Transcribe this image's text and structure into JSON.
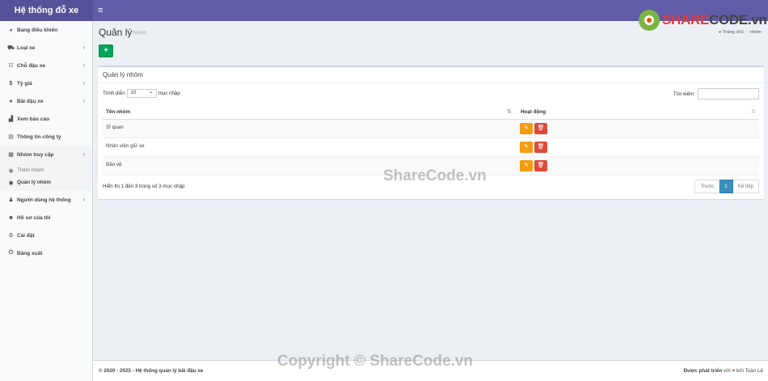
{
  "app": {
    "brand": "Hệ thống đỗ xe",
    "menu_icon": "bars-icon"
  },
  "logo": {
    "part1": "SHARE",
    "part2": "CODE",
    "suffix": ".vn"
  },
  "sidebar": {
    "items": [
      {
        "label": "Bảng điều khiển",
        "icon": "dashboard-icon",
        "has_children": false
      },
      {
        "label": "Loại xe",
        "icon": "car-icon",
        "has_children": true
      },
      {
        "label": "Chỗ đậu xe",
        "icon": "list-icon",
        "has_children": true
      },
      {
        "label": "Tỷ giá",
        "icon": "dollar-icon",
        "has_children": true
      },
      {
        "label": "Bãi đậu xe",
        "icon": "parking-icon",
        "has_children": true
      },
      {
        "label": "Xem báo cáo",
        "icon": "chart-icon",
        "has_children": false
      },
      {
        "label": "Thông tin công ty",
        "icon": "building-icon",
        "has_children": false
      },
      {
        "label": "Nhóm truy cập",
        "icon": "grid-icon",
        "has_children": true
      },
      {
        "label": "Người dùng hệ thống",
        "icon": "user-icon",
        "has_children": true
      },
      {
        "label": "Hồ sơ của tôi",
        "icon": "user-circle-icon",
        "has_children": false
      },
      {
        "label": "Cài đặt",
        "icon": "gears-icon",
        "has_children": false
      },
      {
        "label": "Đăng xuất",
        "icon": "power-icon",
        "has_children": false
      }
    ],
    "sub_items": [
      {
        "label": "Thêm nhóm"
      },
      {
        "label": "Quản lý nhóm"
      }
    ]
  },
  "header": {
    "title": "Quản lý",
    "subtitle": "Nhóm",
    "breadcrumb_home": "Trang chủ",
    "breadcrumb_current": "nhóm"
  },
  "toolbar": {
    "add_label": "+"
  },
  "box": {
    "title": "Quản lý nhóm",
    "length_prefix": "Trình diễn",
    "length_value": "10",
    "length_suffix": "mục nhập",
    "search_label": "Tìm kiếm:",
    "search_value": ""
  },
  "table": {
    "columns": [
      "Tên nhóm",
      "Hoạt động"
    ],
    "rows": [
      {
        "name": "Sĩ quan"
      },
      {
        "name": "Nhân viên giữ xe"
      },
      {
        "name": "Bảo vệ"
      }
    ]
  },
  "info": "Hiển thị 1 đến 3 trong số 3 mục nhập",
  "pagination": {
    "prev": "Trước",
    "current": "1",
    "next": "Kế tiếp"
  },
  "footer": {
    "copyright": "© 2020 - 2025 - Hệ thống quản lý bãi đậu xe",
    "developed_by": "Được phát triển",
    "with": "với",
    "by": "bởi Toàn Lê"
  },
  "watermarks": {
    "center": "ShareCode.vn",
    "bottom": "Copyright © ShareCode.vn"
  }
}
